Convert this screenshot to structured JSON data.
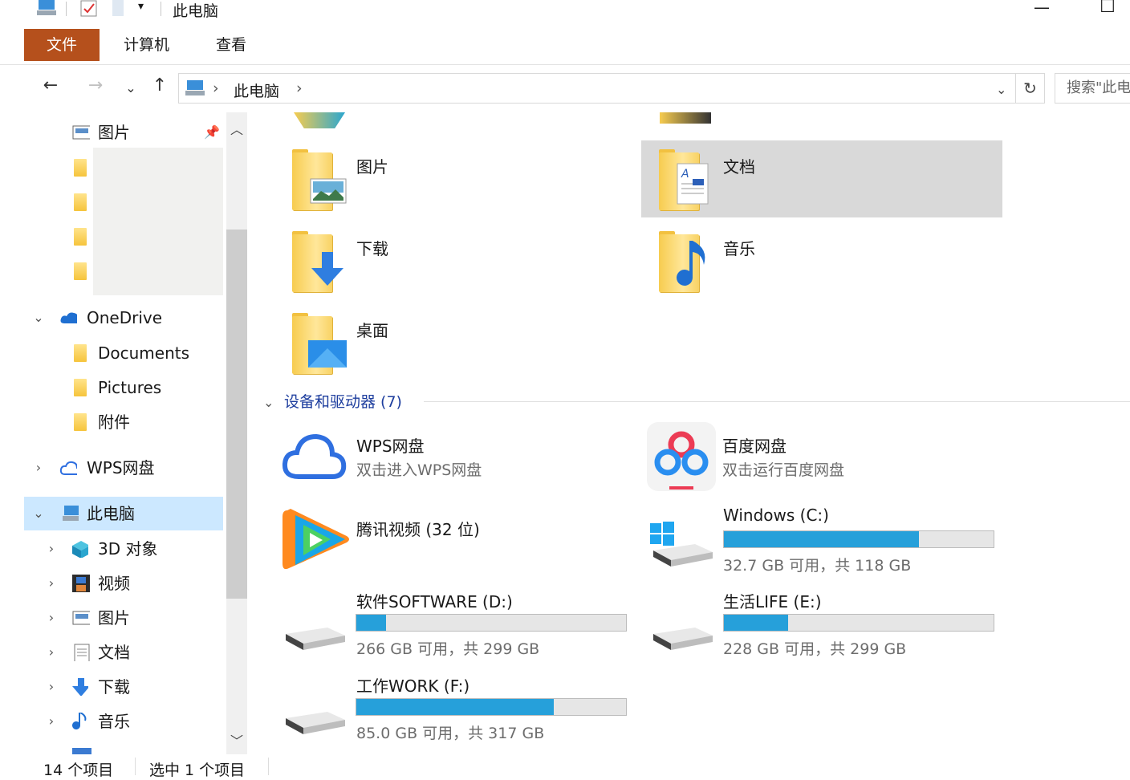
{
  "window": {
    "title": "此电脑",
    "minimize": "—",
    "maximize": "☐"
  },
  "ribbon": {
    "tabs": [
      "文件",
      "计算机",
      "查看"
    ]
  },
  "address": {
    "crumb": "此电脑",
    "search_placeholder": "搜索\"此电脑\""
  },
  "sidebar": {
    "pinned": {
      "label": "图片"
    },
    "onedrive": {
      "label": "OneDrive",
      "children": [
        "Documents",
        "Pictures",
        "附件"
      ]
    },
    "wps": {
      "label": "WPS网盘"
    },
    "thispc": {
      "label": "此电脑",
      "children": [
        "3D 对象",
        "视频",
        "图片",
        "文档",
        "下载",
        "音乐"
      ]
    }
  },
  "content": {
    "folders": [
      {
        "name": "图片",
        "overlay": "picture-icon"
      },
      {
        "name": "文档",
        "overlay": "document-icon",
        "selected": true
      },
      {
        "name": "下载",
        "overlay": "download-arrow-icon"
      },
      {
        "name": "音乐",
        "overlay": "music-note-icon"
      },
      {
        "name": "桌面",
        "overlay": "desktop-icon"
      }
    ],
    "devices_header": "设备和驱动器 (7)",
    "apps": [
      {
        "name": "WPS网盘",
        "subtitle": "双击进入WPS网盘"
      },
      {
        "name": "百度网盘",
        "subtitle": "双击运行百度网盘"
      },
      {
        "name": "腾讯视频 (32 位)"
      }
    ],
    "drives": [
      {
        "name": "Windows (C:)",
        "free_text": "32.7 GB 可用，共 118 GB",
        "used_fraction": 0.723
      },
      {
        "name": "软件SOFTWARE (D:)",
        "free_text": "266 GB 可用，共 299 GB",
        "used_fraction": 0.11
      },
      {
        "name": "生活LIFE (E:)",
        "free_text": "228 GB 可用，共 299 GB",
        "used_fraction": 0.237
      },
      {
        "name": "工作WORK (F:)",
        "free_text": "85.0 GB 可用，共 317 GB",
        "used_fraction": 0.732
      }
    ]
  },
  "status": {
    "count": "14 个项目",
    "selection": "选中 1 个项目"
  },
  "colors": {
    "file_tab": "#b5501c",
    "selection": "#cce8ff",
    "drive_fill": "#26a0da",
    "section_header": "#1e3e9e"
  }
}
